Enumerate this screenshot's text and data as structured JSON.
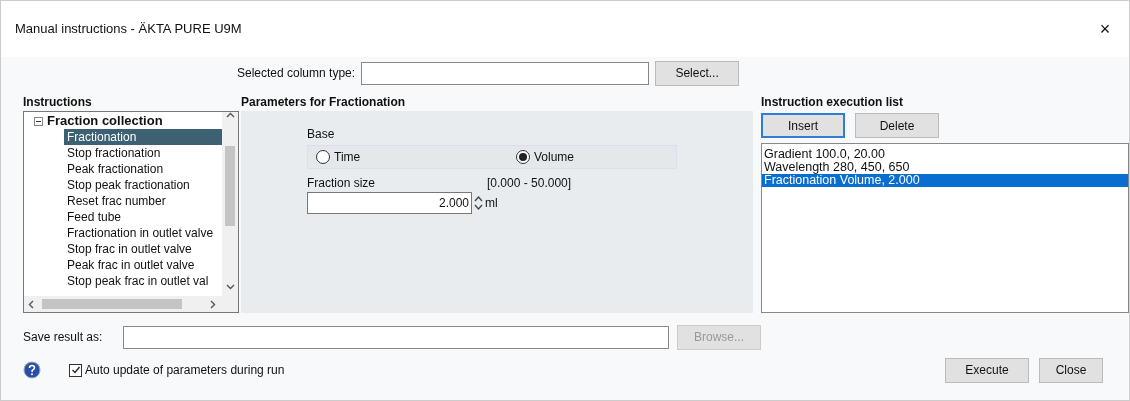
{
  "window": {
    "title": "Manual instructions - ÄKTA PURE U9M",
    "close": "×"
  },
  "column_type": {
    "label": "Selected column type:",
    "button": "Select..."
  },
  "instructions": {
    "heading": "Instructions",
    "group": {
      "label": "Fraction collection",
      "expanded": true,
      "children": [
        {
          "label": "Fractionation",
          "selected": true
        },
        {
          "label": "Stop fractionation",
          "selected": false
        },
        {
          "label": "Peak fractionation",
          "selected": false
        },
        {
          "label": "Stop peak fractionation",
          "selected": false
        },
        {
          "label": "Reset frac number",
          "selected": false
        },
        {
          "label": "Feed tube",
          "selected": false
        },
        {
          "label": "Fractionation in outlet valve",
          "selected": false
        },
        {
          "label": "Stop frac in outlet valve",
          "selected": false
        },
        {
          "label": "Peak frac in outlet valve",
          "selected": false
        },
        {
          "label": "Stop peak frac in outlet val",
          "selected": false
        }
      ]
    }
  },
  "parameters": {
    "heading": "Parameters for Fractionation",
    "base_label": "Base",
    "base_options": [
      {
        "label": "Time",
        "selected": false
      },
      {
        "label": "Volume",
        "selected": true
      }
    ],
    "fraction_size": {
      "label": "Fraction size",
      "range": "[0.000 - 50.000]",
      "value": "2.000",
      "unit": "ml"
    }
  },
  "execution_list": {
    "heading": "Instruction execution list",
    "buttons": [
      "Insert",
      "Delete"
    ],
    "items": [
      {
        "label": "Gradient 100.0, 20.00",
        "selected": false
      },
      {
        "label": "Wavelength 280, 450, 650",
        "selected": false
      },
      {
        "label": "Fractionation Volume, 2.000",
        "selected": true
      }
    ]
  },
  "save": {
    "label": "Save result as:",
    "button": "Browse...",
    "button_disabled": true
  },
  "auto_update": {
    "label": "Auto update of parameters during run",
    "checked": true
  },
  "footer_buttons": [
    "Execute",
    "Close"
  ]
}
